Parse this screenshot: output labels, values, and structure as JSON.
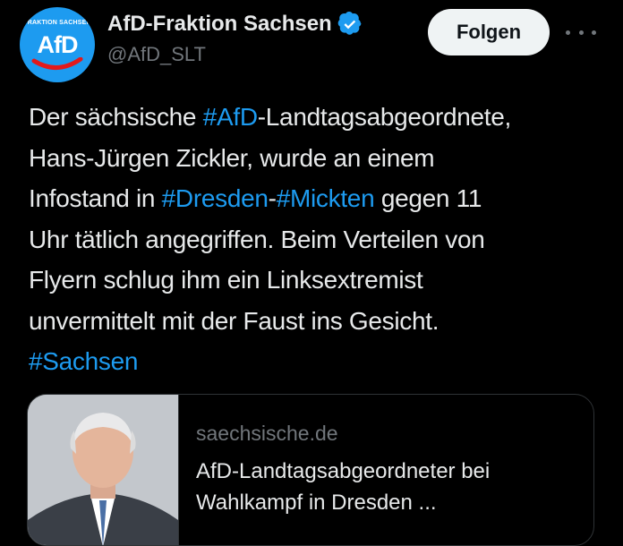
{
  "author": {
    "avatar_top_text": "FRAKTION SACHSEN",
    "avatar_logo_text": "AfD",
    "display_name": "AfD-Fraktion Sachsen",
    "handle": "@AfD_SLT",
    "verified_icon": "verified-badge-icon"
  },
  "actions": {
    "follow_label": "Folgen",
    "more_icon": "more-options-icon"
  },
  "tweet": {
    "lines": [
      [
        {
          "text": "Der sächsische ",
          "hashtag": false
        },
        {
          "text": "#AfD",
          "hashtag": true
        },
        {
          "text": "-Landtagsabgeordnete,",
          "hashtag": false
        }
      ],
      [
        {
          "text": "Hans-Jürgen Zickler, wurde an einem",
          "hashtag": false
        }
      ],
      [
        {
          "text": "Infostand in ",
          "hashtag": false
        },
        {
          "text": "#Dresden",
          "hashtag": true
        },
        {
          "text": "-",
          "hashtag": false
        },
        {
          "text": "#Mickten",
          "hashtag": true
        },
        {
          "text": " gegen 11",
          "hashtag": false
        }
      ],
      [
        {
          "text": "Uhr tätlich angegriffen. Beim Verteilen von",
          "hashtag": false
        }
      ],
      [
        {
          "text": "Flyern schlug ihm ein Linksextremist",
          "hashtag": false
        }
      ],
      [
        {
          "text": "unvermittelt mit der Faust ins Gesicht.",
          "hashtag": false
        }
      ],
      [
        {
          "text": "#Sachsen",
          "hashtag": true
        }
      ]
    ]
  },
  "link_card": {
    "domain": "saechsische.de",
    "title_lines": [
      "AfD-Landtagsabgeordneter bei",
      "Wahlkampf in Dresden ..."
    ]
  },
  "colors": {
    "background": "#000000",
    "text": "#e7e9ea",
    "muted": "#71767b",
    "accent": "#1d9bf0",
    "follow_bg": "#eff3f4"
  }
}
